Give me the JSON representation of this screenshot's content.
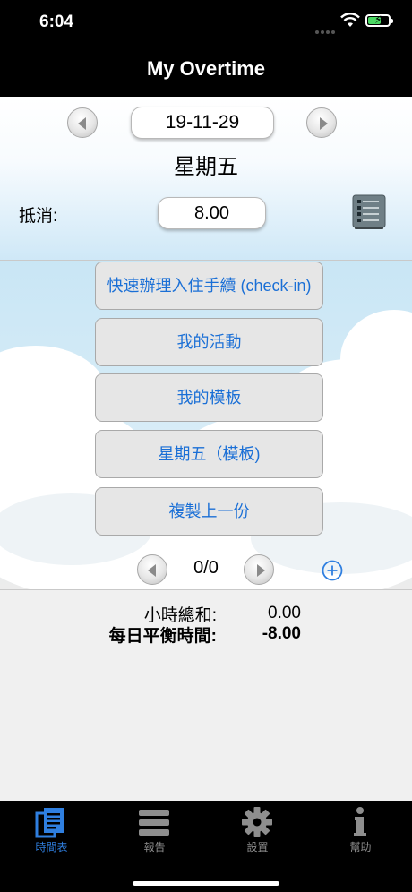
{
  "status_bar": {
    "time": "6:04"
  },
  "nav": {
    "title": "My Overtime"
  },
  "date_selector": {
    "date": "19-11-29",
    "weekday": "星期五"
  },
  "offset": {
    "label": "抵消:",
    "value": "8.00"
  },
  "menu": [
    {
      "label": "快速辦理入住手續 (check-in)"
    },
    {
      "label": "我的活動"
    },
    {
      "label": "我的模板"
    },
    {
      "label": "星期五（模板)"
    },
    {
      "label": "複製上一份"
    }
  ],
  "pager": {
    "text": "0/0"
  },
  "summary": {
    "hours_total_label": "小時總和:",
    "hours_total_value": "0.00",
    "daily_balance_label": "每日平衡時間:",
    "daily_balance_value": "-8.00"
  },
  "tabs": [
    {
      "label": "時間表",
      "icon": "document-icon",
      "active": true
    },
    {
      "label": "報告",
      "icon": "list-icon",
      "active": false
    },
    {
      "label": "設置",
      "icon": "gear-icon",
      "active": false
    },
    {
      "label": "幫助",
      "icon": "info-icon",
      "active": false
    }
  ],
  "colors": {
    "accent": "#2f7fe0",
    "menu_text": "#1a6fd6",
    "bar_background": "#000000"
  }
}
